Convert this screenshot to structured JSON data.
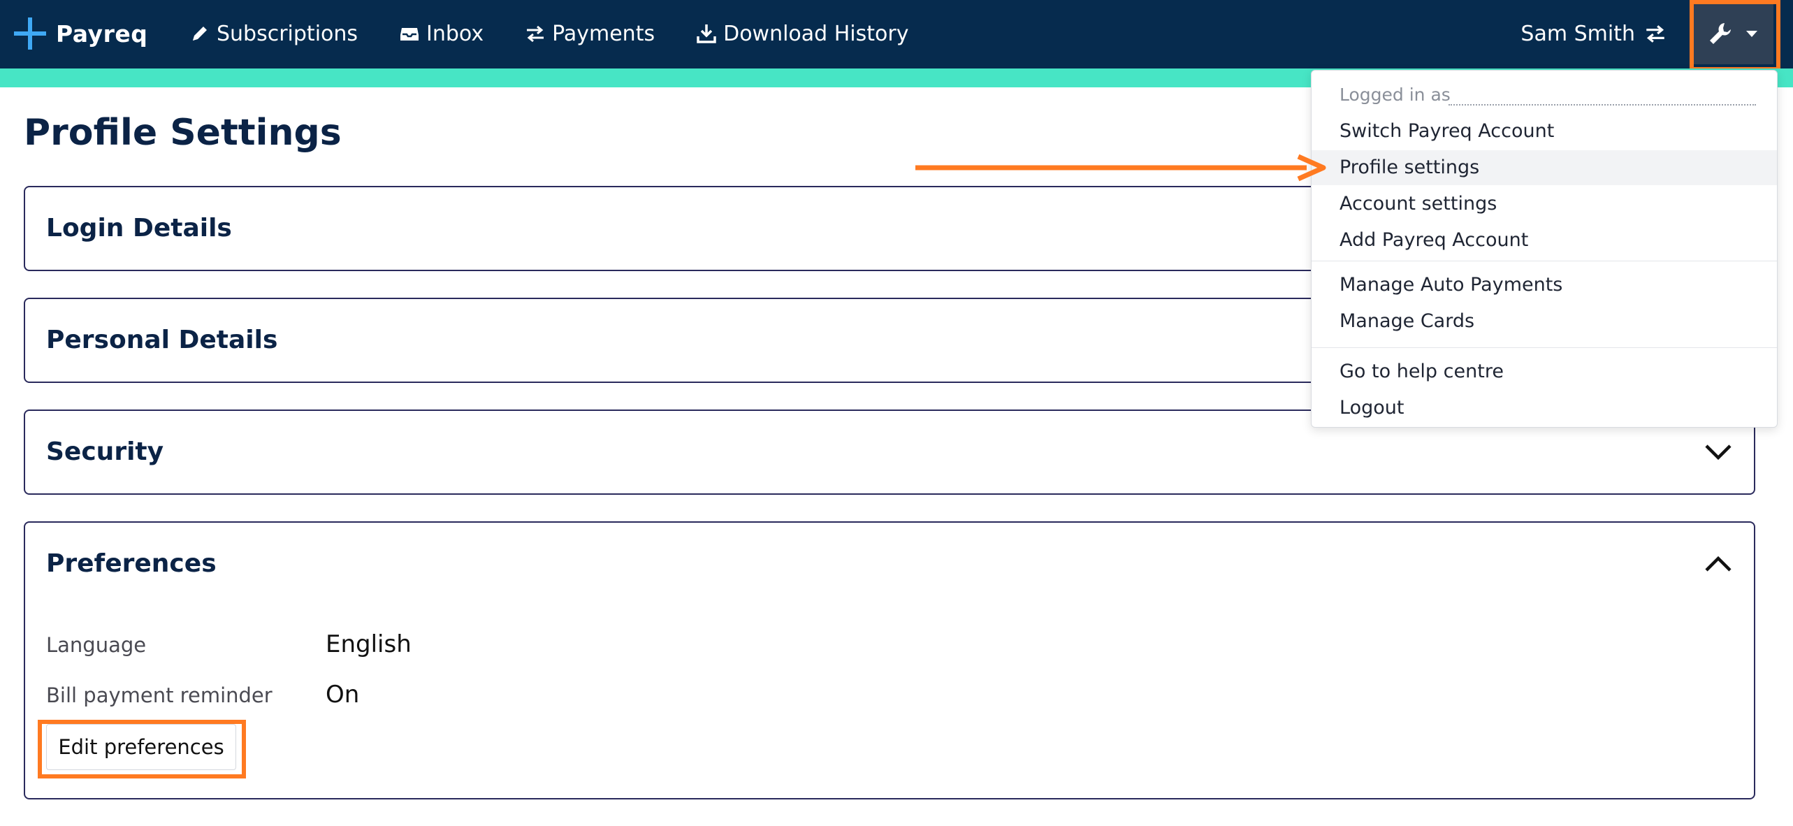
{
  "brand": {
    "name": "Payreq"
  },
  "nav": {
    "items": [
      {
        "label": "Subscriptions",
        "icon": "pencil-icon"
      },
      {
        "label": "Inbox",
        "icon": "inbox-icon"
      },
      {
        "label": "Payments",
        "icon": "transfer-arrows-icon"
      },
      {
        "label": "Download History",
        "icon": "download-icon"
      }
    ]
  },
  "user": {
    "name": "Sam Smith",
    "switch_icon": "transfer-arrows-icon"
  },
  "settings_menu": {
    "icon": "wrench-icon",
    "logged_in_label": "Logged in as",
    "items": [
      "Switch Payreq Account",
      "Profile settings",
      "Account settings",
      "Add Payreq Account",
      "Manage Auto Payments",
      "Manage Cards",
      "Go to help centre",
      "Logout"
    ]
  },
  "page": {
    "title": "Profile Settings"
  },
  "panels": [
    {
      "title": "Login Details",
      "expanded": false
    },
    {
      "title": "Personal Details",
      "expanded": false
    },
    {
      "title": "Security",
      "expanded": false
    },
    {
      "title": "Preferences",
      "expanded": true
    }
  ],
  "preferences": {
    "rows": [
      {
        "label": "Language",
        "value": "English"
      },
      {
        "label": "Bill payment reminder",
        "value": "On"
      }
    ],
    "edit_button": "Edit preferences"
  },
  "colors": {
    "topbar": "#062b4e",
    "accent_strip": "#47e5c5",
    "highlight": "#ff7a21",
    "heading": "#0b2346"
  }
}
